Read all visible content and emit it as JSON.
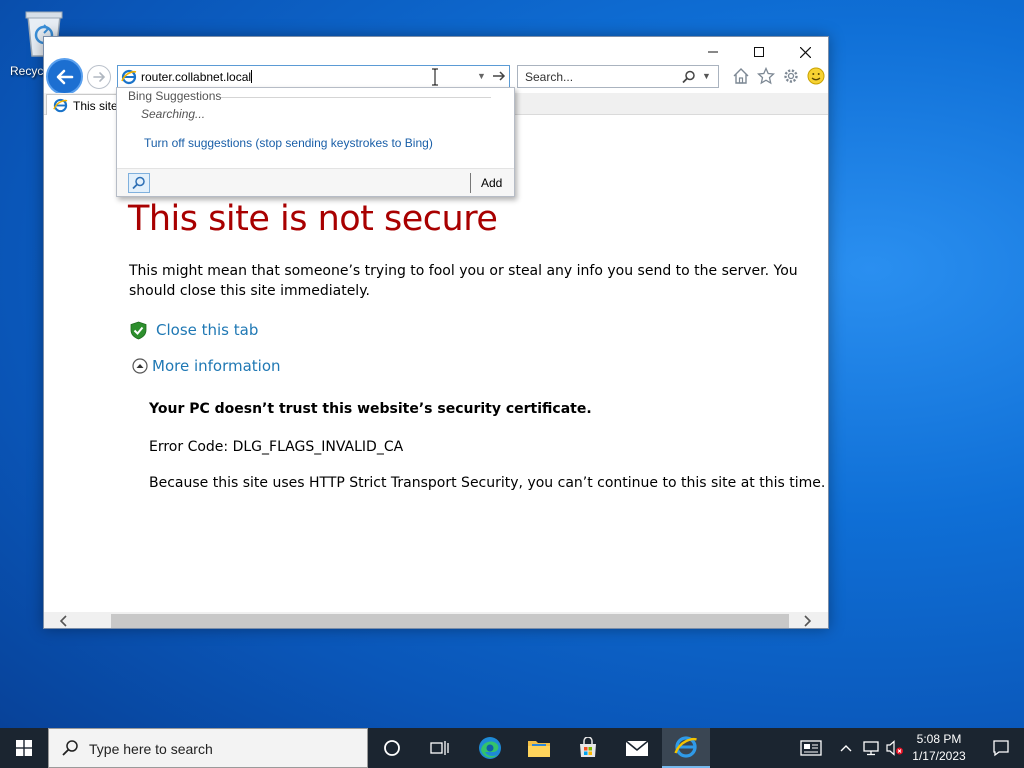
{
  "desktop": {
    "recycle_bin_label": "Recycl"
  },
  "browser": {
    "window_controls": {
      "minimize": "—",
      "maximize": "☐",
      "close": "✕"
    },
    "address": {
      "value": "router.collabnet.local"
    },
    "search": {
      "placeholder": "Search..."
    },
    "toolbar_icons": [
      "home-icon",
      "favorites-star-icon",
      "settings-gear-icon",
      "feedback-smiley-icon"
    ],
    "tab": {
      "label": "This site"
    },
    "suggestions": {
      "heading": "Bing Suggestions",
      "status": "Searching...",
      "turn_off": "Turn off suggestions (stop sending keystrokes to Bing)",
      "add_label": "Add"
    },
    "page": {
      "title": "This site is not secure",
      "description": "This might mean that someone’s trying to fool you or steal any info you send to the server. You should close this site immediately.",
      "close_tab": "Close this tab",
      "more_info": "More information",
      "detail_heading": "Your PC doesn’t trust this website’s security certificate.",
      "error_code": "Error Code: DLG_FLAGS_INVALID_CA",
      "hsts_note": "Because this site uses HTTP Strict Transport Security, you can’t continue to this site at this time."
    },
    "colors": {
      "title_red": "#a80000",
      "link_blue": "#1f78b4",
      "back_button_blue": "#1c6fd1"
    }
  },
  "taskbar": {
    "search_placeholder": "Type here to search",
    "pinned_apps": [
      "task-view-icon",
      "edge-icon",
      "file-explorer-icon",
      "store-icon",
      "mail-icon",
      "internet-explorer-icon"
    ],
    "clock": {
      "time": "5:08 PM",
      "date": "1/17/2023"
    }
  }
}
